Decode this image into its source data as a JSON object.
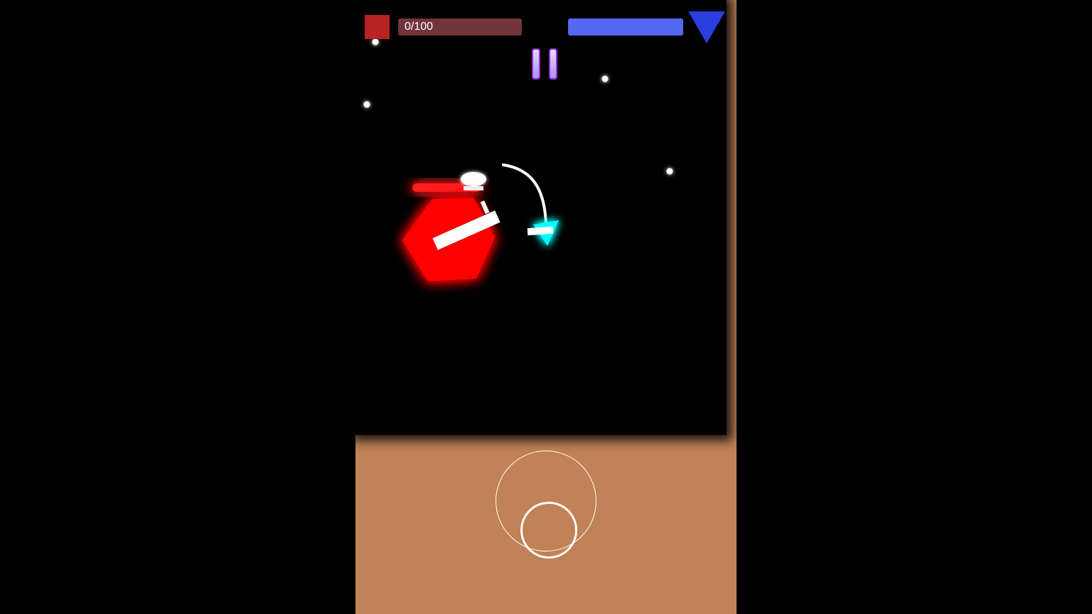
{
  "hud": {
    "health_text": "0/100",
    "health_fraction": 0.0,
    "energy_fraction": 1.0,
    "direction_icon": "triangle-down-icon",
    "pause_icon": "pause-icon"
  },
  "colors": {
    "background": "#000000",
    "floor": "#c08256",
    "health": "#b72225",
    "energy": "#5468f1",
    "enemy": "#ff0000",
    "player": "#00ffff",
    "direction": "#2a3ee0"
  }
}
